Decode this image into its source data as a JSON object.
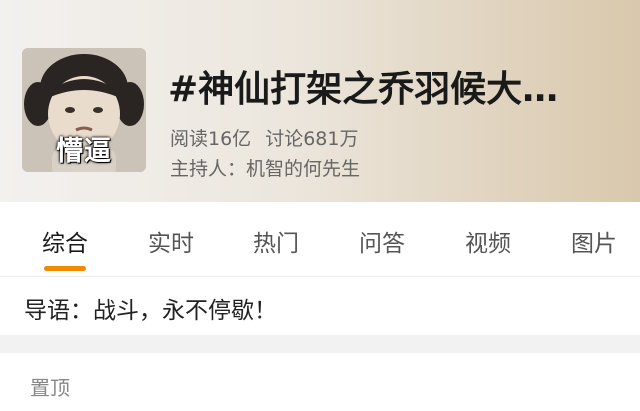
{
  "header": {
    "avatar_caption": "懵逼",
    "title": "#神仙打架之乔羽候大…",
    "reads": "阅读16亿",
    "discussions": "讨论681万",
    "host": "主持人：机智的何先生"
  },
  "tabs": [
    {
      "label": "综合"
    },
    {
      "label": "实时"
    },
    {
      "label": "热门"
    },
    {
      "label": "问答"
    },
    {
      "label": "视频"
    },
    {
      "label": "图片"
    }
  ],
  "guide": {
    "text": "导语：战斗，永不停歇！"
  },
  "pinned": {
    "label": "置顶"
  },
  "colors": {
    "accent": "#f08a00",
    "header_gradient_end": "#d9c8ac"
  }
}
